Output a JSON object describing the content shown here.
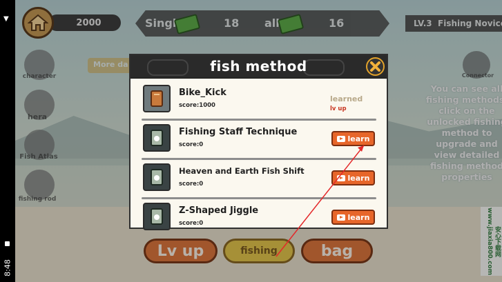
{
  "status_bar": {
    "time": "8:48"
  },
  "top_bar": {
    "gold": "2000",
    "single_label": "Single",
    "single_value": "18",
    "all_label": "all",
    "all_value": "16",
    "level": "LV.3",
    "level_title": "Fishing Novice"
  },
  "side_menu": [
    {
      "label": "character"
    },
    {
      "label": "hera"
    },
    {
      "label": "Fish Atlas"
    },
    {
      "label": "fishing rod"
    }
  ],
  "more_tag": "More da",
  "connector_label": "Connector",
  "right_hint": "You can see all fishing methods, click on the unlocked fishing method to upgrade and view detailed fishing method properties",
  "bottom_buttons": {
    "lv_up": "Lv up",
    "fishing": "fishing",
    "bag": "bag"
  },
  "modal": {
    "title": "fish method",
    "methods": [
      {
        "name": "Bike_Kick",
        "score": "score:1000",
        "status": "learned",
        "sub": "lv up"
      },
      {
        "name": "Fishing Staff Technique",
        "score": "score:0",
        "action": "learn"
      },
      {
        "name": "Heaven and Earth Fish Shift",
        "score": "score:0",
        "action": "learn"
      },
      {
        "name": "Z-Shaped Jiggle",
        "score": "score:0",
        "action": "learn"
      }
    ]
  },
  "watermark": "安心下载网 www.jiaxia800.com",
  "colors": {
    "accent_orange": "#e7662a",
    "close_gold": "#e3a32b",
    "learned_text": "#b8a98a",
    "lvup_red": "#c8341f"
  }
}
